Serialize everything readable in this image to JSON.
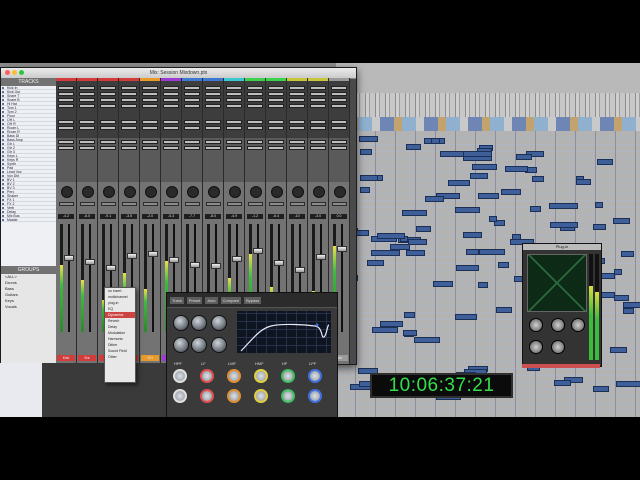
{
  "mix_window": {
    "title": "Mix: Session Mixdown.ptx",
    "tracks_header": "TRACKS",
    "groups_header": "GROUPS",
    "tracks": [
      "Kick In",
      "Kick Out",
      "Snare T",
      "Snare B",
      "Hi Hat",
      "Tom 1",
      "Tom 2",
      "Floor",
      "OH L",
      "OH R",
      "Room L",
      "Room R",
      "Bass DI",
      "Bass Amp",
      "Gtr 1",
      "Gtr 2",
      "Gtr 3",
      "Keys L",
      "Keys R",
      "Synth",
      "Pad",
      "Lead Vox",
      "Vox Dbl",
      "BV 1",
      "BV 2",
      "BV 3",
      "Perc",
      "Shaker",
      "FX 1",
      "FX 2",
      "Verb",
      "Delay",
      "Mix Bus",
      "Master"
    ],
    "groups": [
      "<ALL>",
      "Drums",
      "Bass",
      "Guitars",
      "Keys",
      "Vocals"
    ],
    "strips": [
      {
        "name": "Kick",
        "vol": "-4.2",
        "color": "#d23c3c",
        "meter": 0.62,
        "fader": 0.7
      },
      {
        "name": "Snr",
        "vol": "-6.0",
        "color": "#d23c3c",
        "meter": 0.48,
        "fader": 0.66
      },
      {
        "name": "HH",
        "vol": "-9.1",
        "color": "#d23c3c",
        "meter": 0.3,
        "fader": 0.6
      },
      {
        "name": "Tom",
        "vol": "-3.5",
        "color": "#d23c3c",
        "meter": 0.55,
        "fader": 0.72
      },
      {
        "name": "OH",
        "vol": "-2.0",
        "color": "#e89a2a",
        "meter": 0.4,
        "fader": 0.74
      },
      {
        "name": "Bass",
        "vol": "-5.3",
        "color": "#9c3cd2",
        "meter": 0.66,
        "fader": 0.68
      },
      {
        "name": "Gtr1",
        "vol": "-7.7",
        "color": "#3c7ad2",
        "meter": 0.35,
        "fader": 0.63
      },
      {
        "name": "Gtr2",
        "vol": "-8.0",
        "color": "#3c7ad2",
        "meter": 0.28,
        "fader": 0.62
      },
      {
        "name": "Keys",
        "vol": "-4.9",
        "color": "#3cc7d2",
        "meter": 0.5,
        "fader": 0.69
      },
      {
        "name": "Vox",
        "vol": "-1.2",
        "color": "#3cd24c",
        "meter": 0.72,
        "fader": 0.76
      },
      {
        "name": "BV",
        "vol": "-6.4",
        "color": "#3cd24c",
        "meter": 0.42,
        "fader": 0.65
      },
      {
        "name": "FX",
        "vol": "-10",
        "color": "#c7c73c",
        "meter": 0.18,
        "fader": 0.58
      },
      {
        "name": "Verb",
        "vol": "-3.0",
        "color": "#c7c73c",
        "meter": 0.38,
        "fader": 0.71
      },
      {
        "name": "Mstr",
        "vol": "0.0",
        "color": "#9a9a9a",
        "meter": 0.8,
        "fader": 0.78
      }
    ]
  },
  "popup_menu": {
    "items": [
      "no insert",
      "multichannel",
      "plug-in",
      "EQ",
      "Dynamics",
      "Reverb",
      "Delay",
      "Modulation",
      "Harmonic",
      "Dither",
      "Sound Field",
      "Other"
    ],
    "selected_index": 4
  },
  "eq_plugin": {
    "header_controls": [
      "Track",
      "Preset",
      "Auto",
      "Compare",
      "Bypass"
    ],
    "band_labels": [
      "HPF",
      "LF",
      "LMF",
      "HMF",
      "HF",
      "LPF"
    ],
    "band_colors": [
      "#e0e0e0",
      "#e05050",
      "#e09030",
      "#e0d040",
      "#3cc060",
      "#4070e0"
    ]
  },
  "stereo_panner": {
    "title": "Plug-in"
  },
  "big_counter": {
    "timecode": "10:06:37:21"
  },
  "colors": {
    "counter_text": "#34e04a",
    "meter_green": "#3dbb3d"
  }
}
